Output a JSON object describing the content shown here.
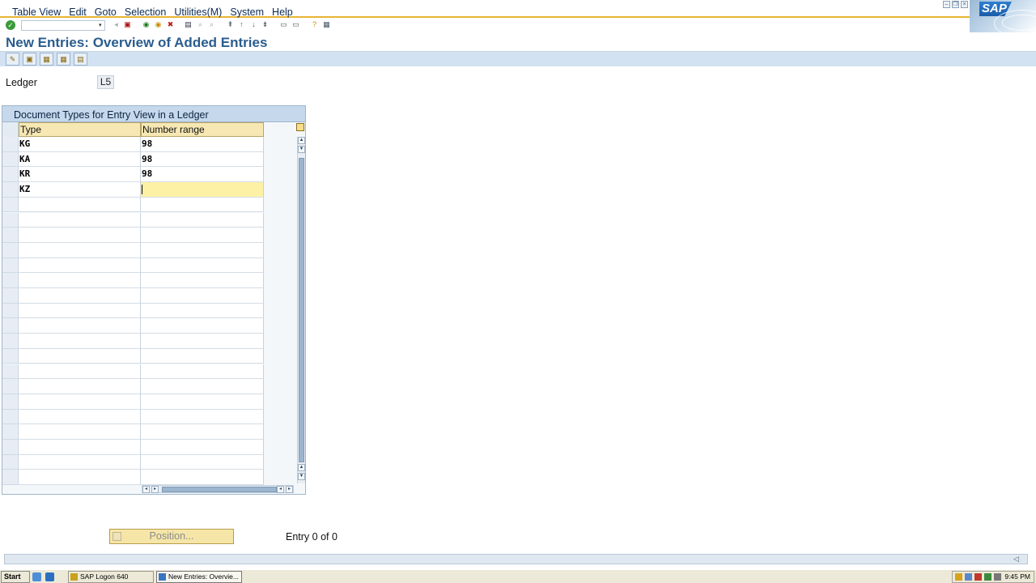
{
  "menu": {
    "items": [
      "Table View",
      "Edit",
      "Goto",
      "Selection",
      "Utilities(M)",
      "System",
      "Help"
    ]
  },
  "branding": {
    "logo_text": "SAP"
  },
  "page": {
    "title": "New Entries: Overview of Added Entries"
  },
  "ledger": {
    "label": "Ledger",
    "value": "L5"
  },
  "table": {
    "title": "Document Types for Entry View in a Ledger",
    "columns": [
      "Type",
      "Number range"
    ],
    "rows": [
      {
        "type": "KG",
        "number_range": "98"
      },
      {
        "type": "KA",
        "number_range": "98"
      },
      {
        "type": "KR",
        "number_range": "98"
      },
      {
        "type": "KZ",
        "number_range": ""
      }
    ],
    "active_cell": {
      "row": 3,
      "column": "number_range"
    }
  },
  "footer": {
    "position_button": "Position...",
    "entry_info": "Entry 0 of 0"
  },
  "taskbar": {
    "start_label": "Start",
    "tasks": [
      {
        "label": "SAP Logon 640",
        "active": false
      },
      {
        "label": "New Entries: Overvie...",
        "active": true
      }
    ],
    "clock": "9:45 PM"
  },
  "colors": {
    "title_blue": "#2a5d8f",
    "header_gold": "#f7e8b3",
    "active_cell": "#fdf1a6",
    "toolbar_blue": "#d3e2f2"
  }
}
